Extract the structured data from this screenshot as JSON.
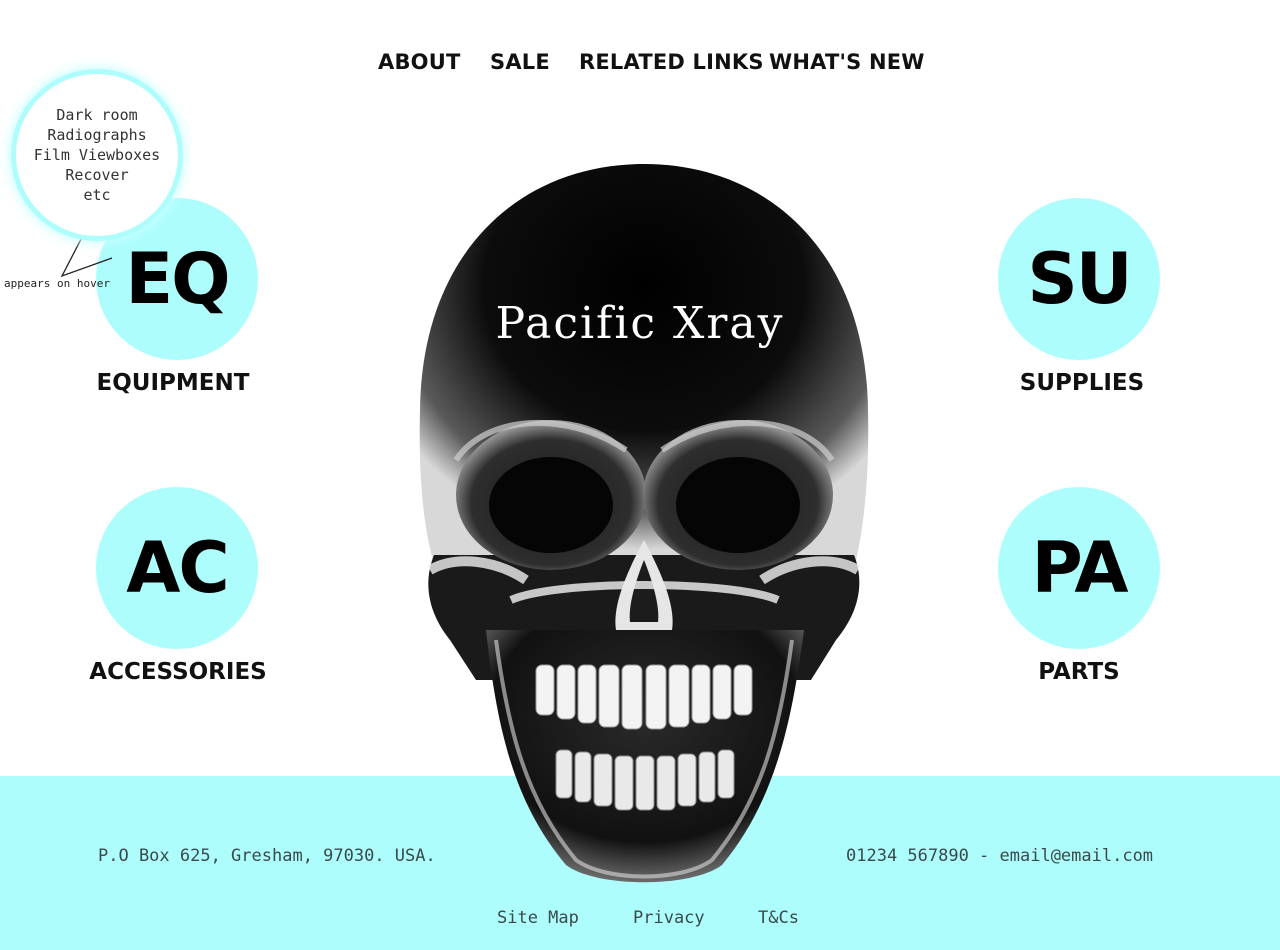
{
  "nav": {
    "items": [
      "ABOUT",
      "SALE",
      "RELATED LINKS",
      "WHAT'S NEW"
    ]
  },
  "brand": {
    "title": "Pacific Xray"
  },
  "categories": [
    {
      "abbr": "EQ",
      "label": "EQUIPMENT"
    },
    {
      "abbr": "SU",
      "label": "SUPPLIES"
    },
    {
      "abbr": "AC",
      "label": "ACCESSORIES"
    },
    {
      "abbr": "PA",
      "label": "PARTS"
    }
  ],
  "hover_popup": {
    "lines": [
      "Dark room",
      "Radiographs",
      "Film Viewboxes",
      "Recover",
      "etc"
    ],
    "annotation": "appears on hover"
  },
  "footer": {
    "address": "P.O Box 625, Gresham, 97030. USA.",
    "contact": "01234 567890 - email@email.com",
    "links": [
      "Site Map",
      "Privacy",
      "T&Cs"
    ]
  },
  "colors": {
    "accent": "#aefdfd",
    "text": "#111111",
    "background": "#ffffff"
  }
}
